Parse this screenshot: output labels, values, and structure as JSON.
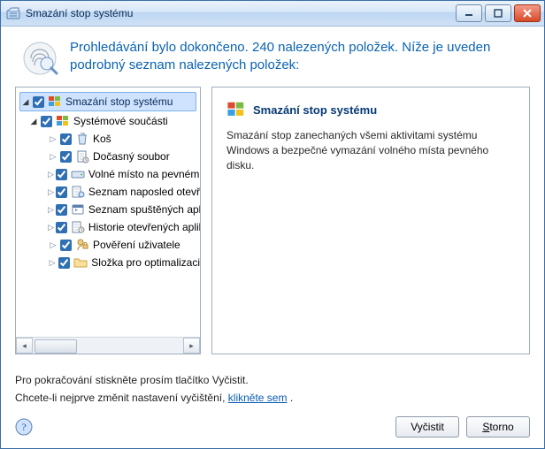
{
  "window": {
    "title": "Smazání stop systému"
  },
  "header": {
    "text": "Prohledávání bylo dokončeno. 240 nalezených položek. Níže je uveden podrobný seznam nalezených položek:"
  },
  "tree": {
    "root": {
      "label": "Smazání stop systému",
      "checked": true
    },
    "group": {
      "label": "Systémové součásti",
      "checked": true
    },
    "items": [
      {
        "label": "Koš",
        "checked": true
      },
      {
        "label": "Dočasný soubor",
        "checked": true
      },
      {
        "label": "Volné místo na pevném disku",
        "checked": true
      },
      {
        "label": "Seznam naposled otevřených",
        "checked": true
      },
      {
        "label": "Seznam spuštěných aplikací",
        "checked": true
      },
      {
        "label": "Historie otevřených aplikací",
        "checked": true
      },
      {
        "label": "Pověření uživatele",
        "checked": true
      },
      {
        "label": "Složka pro optimalizaci",
        "checked": true
      }
    ]
  },
  "detail": {
    "title": "Smazání stop systému",
    "desc": "Smazání stop zanechaných všemi aktivitami systému Windows a bezpečné vymazání volného místa pevného disku."
  },
  "footer": {
    "line1": "Pro pokračování stiskněte prosím tlačítko Vyčistit.",
    "line2_prefix": "Chcete-li nejprve změnit nastavení vyčištění, ",
    "line2_link": "klikněte sem",
    "line2_suffix": " ."
  },
  "buttons": {
    "clean": "Vyčistit",
    "cancel": "Storno"
  }
}
